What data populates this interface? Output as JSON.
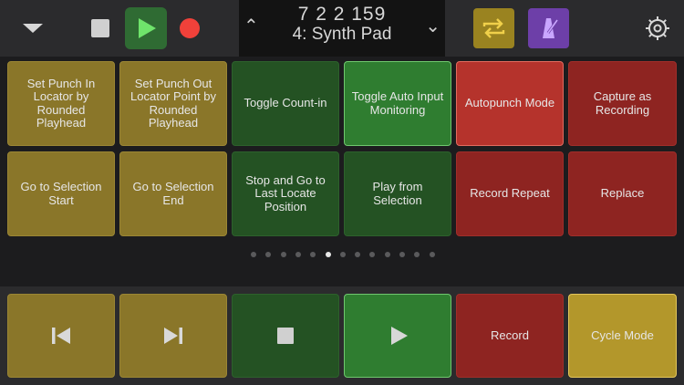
{
  "transport": {
    "position": "7  2  2  159",
    "track": "4: Synth Pad"
  },
  "grid": {
    "row1": [
      {
        "label": "Set Punch In Locator by Rounded Playhead",
        "color": "y"
      },
      {
        "label": "Set Punch Out Locator Point by Rounded Playhead",
        "color": "y"
      },
      {
        "label": "Toggle Count-in",
        "color": "g"
      },
      {
        "label": "Toggle Auto Input Monitoring",
        "color": "gl"
      },
      {
        "label": "Autopunch Mode",
        "color": "rl"
      },
      {
        "label": "Capture as Recording",
        "color": "r"
      }
    ],
    "row2": [
      {
        "label": "Go to Selection Start",
        "color": "y"
      },
      {
        "label": "Go to Selection End",
        "color": "y"
      },
      {
        "label": "Stop and Go to Last Locate Position",
        "color": "g"
      },
      {
        "label": "Play from Selection",
        "color": "g"
      },
      {
        "label": "Record Repeat",
        "color": "r"
      },
      {
        "label": "Replace",
        "color": "r"
      }
    ]
  },
  "pager": {
    "count": 13,
    "active_index": 5
  },
  "bottom": {
    "record_label": "Record",
    "cycle_label": "Cycle Mode"
  },
  "icons": {
    "dropdown": "chevron-down-icon",
    "stop": "stop-icon",
    "play": "play-icon",
    "record": "record-icon",
    "cycle": "cycle-icon",
    "metronome": "metronome-icon",
    "settings": "gear-icon",
    "rewind": "skip-back-icon",
    "forward": "skip-forward-icon"
  },
  "colors": {
    "yellow": "#8a7629",
    "green": "#245223",
    "green_active": "#2f7d30",
    "red": "#8e2421",
    "red_active": "#b5332c",
    "cycle_active": "#b3972b",
    "metronome": "#6d3fa8"
  }
}
